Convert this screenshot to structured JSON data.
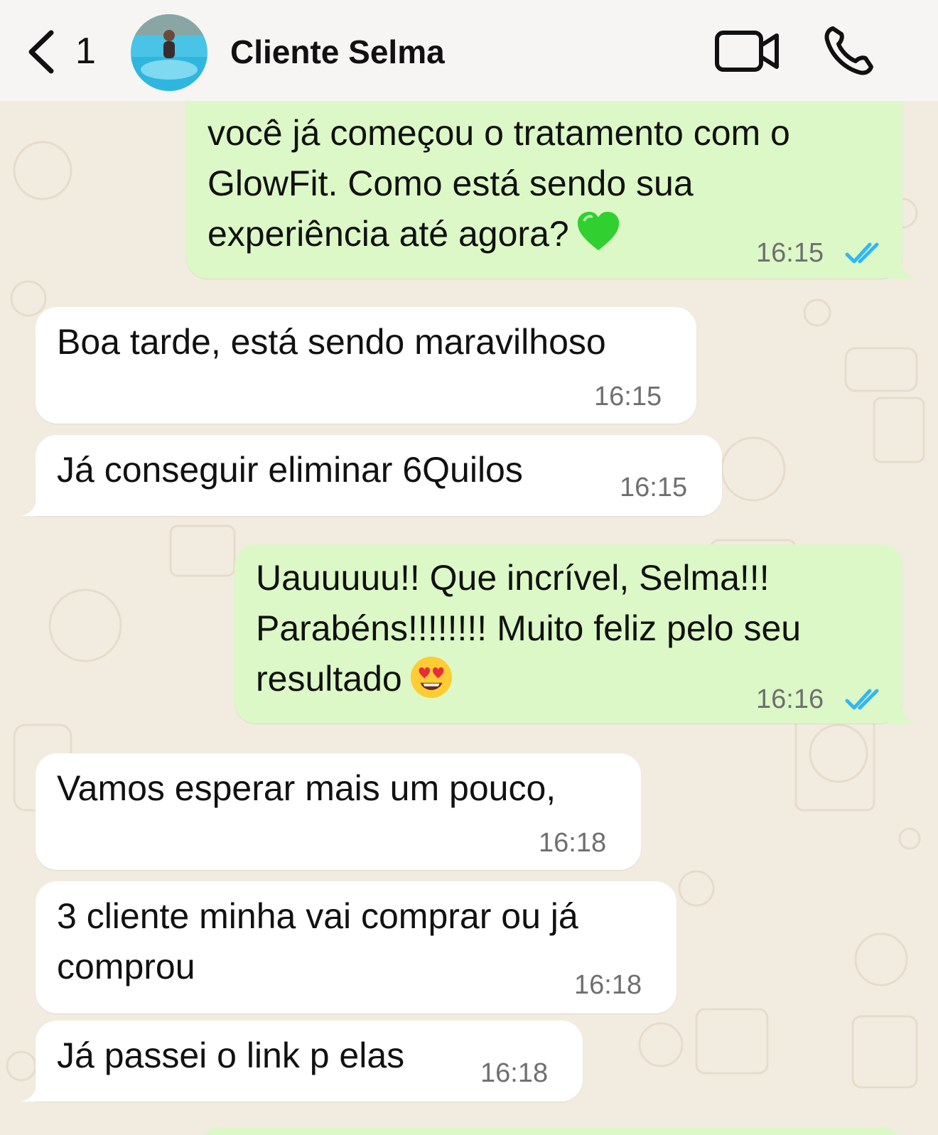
{
  "header": {
    "back_icon": "chevron-left-icon",
    "unread_count": "1",
    "contact_name": "Cliente Selma",
    "video_icon": "video-camera-icon",
    "call_icon": "phone-icon"
  },
  "colors": {
    "outgoing_bubble": "#dcf8c6",
    "incoming_bubble": "#ffffff",
    "read_ticks": "#34b7f1",
    "background": "#f2ebe0"
  },
  "messages": [
    {
      "direction": "outgoing",
      "lines": [
        "você já começou o tratamento com o",
        "GlowFit. Como está sendo sua",
        "experiência até agora?"
      ],
      "emoji": "green-heart",
      "time": "16:15",
      "status": "read"
    },
    {
      "direction": "incoming",
      "lines": [
        "Boa tarde, está sendo maravilhoso"
      ],
      "time": "16:15"
    },
    {
      "direction": "incoming",
      "lines": [
        "Já conseguir eliminar 6Quilos"
      ],
      "time": "16:15"
    },
    {
      "direction": "outgoing",
      "lines": [
        "Uauuuuu!! Que incrível, Selma!!!",
        "Parabéns!!!!!!!! Muito feliz pelo seu",
        "resultado"
      ],
      "emoji": "heart-eyes",
      "time": "16:16",
      "status": "read"
    },
    {
      "direction": "incoming",
      "lines": [
        "Vamos esperar mais um pouco,"
      ],
      "time": "16:18"
    },
    {
      "direction": "incoming",
      "lines": [
        "3 cliente minha vai comprar ou já",
        "comprou"
      ],
      "time": "16:18"
    },
    {
      "direction": "incoming",
      "lines": [
        "Já passei o link p elas"
      ],
      "time": "16:18"
    }
  ]
}
